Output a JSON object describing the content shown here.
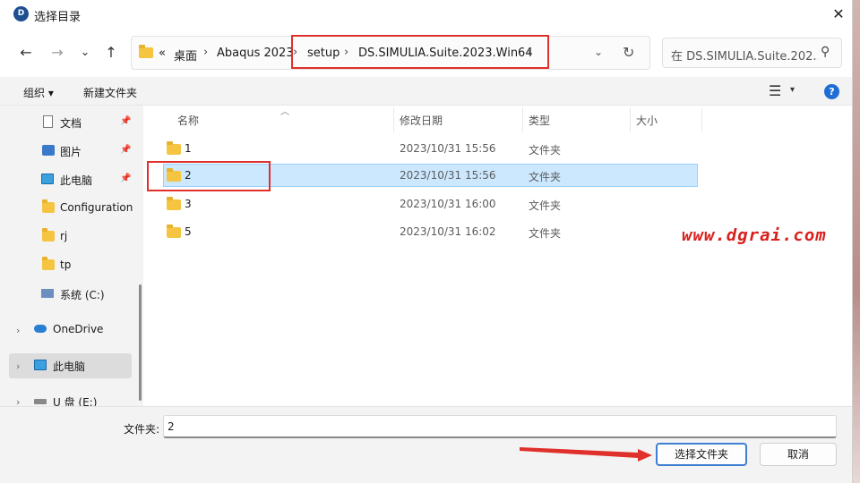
{
  "window": {
    "title": "选择目录",
    "close_glyph": "✕",
    "app_icon_glyph": "D"
  },
  "nav": {
    "back_glyph": "←",
    "forward_glyph": "→",
    "recent_glyph": "⌄",
    "up_glyph": "↑",
    "address": {
      "overflow_glyph": "«",
      "crumbs": [
        "桌面",
        "Abaqus 2023",
        "setup",
        "DS.SIMULIA.Suite.2023.Win64"
      ],
      "sep_glyph": "›",
      "dropdown_glyph": "⌄",
      "refresh_glyph": "↻"
    },
    "search_text": "在 DS.SIMULIA.Suite.202...",
    "search_glyph": "⚲"
  },
  "toolbar": {
    "organize_label": "组织 ▾",
    "new_folder_label": "新建文件夹",
    "view_glyph": "☰",
    "view_dropdown_glyph": "▾",
    "help_glyph": "?"
  },
  "sidebar": {
    "pin_glyph": "📌",
    "expand_glyph": "›",
    "items": [
      {
        "label": "文档",
        "icon": "document-icon",
        "pinned": true
      },
      {
        "label": "图片",
        "icon": "pictures-icon",
        "pinned": true
      },
      {
        "label": "此电脑",
        "icon": "computer-icon",
        "pinned": true
      },
      {
        "label": "Configuration",
        "icon": "folder-icon"
      },
      {
        "label": "rj",
        "icon": "folder-icon"
      },
      {
        "label": "tp",
        "icon": "folder-icon"
      },
      {
        "label": "系统 (C:)",
        "icon": "drive-icon"
      },
      {
        "label": "OneDrive",
        "icon": "onedrive-icon"
      },
      {
        "label": "此电脑",
        "icon": "computer-icon",
        "selected": true
      },
      {
        "label": "U 盘 (E:)",
        "icon": "usb-drive-icon"
      }
    ]
  },
  "filelist": {
    "sort_glyph": "︿",
    "columns": [
      "名称",
      "修改日期",
      "类型",
      "大小"
    ],
    "rows": [
      {
        "name": "1",
        "date": "2023/10/31 15:56",
        "type": "文件夹"
      },
      {
        "name": "2",
        "date": "2023/10/31 15:56",
        "type": "文件夹",
        "selected": true
      },
      {
        "name": "3",
        "date": "2023/10/31 16:00",
        "type": "文件夹"
      },
      {
        "name": "5",
        "date": "2023/10/31 16:02",
        "type": "文件夹"
      }
    ]
  },
  "watermark": "www.dgrai.com",
  "bottom": {
    "folder_label": "文件夹:",
    "folder_value": "2",
    "select_button": "选择文件夹",
    "cancel_button": "取消"
  },
  "colors": {
    "annotation_red": "#e0302b",
    "selection": "#cce8ff",
    "accent": "#3f7fd1"
  }
}
